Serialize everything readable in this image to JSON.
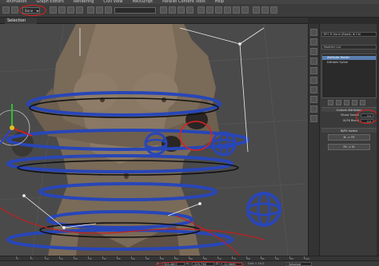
{
  "menu": {
    "items": [
      "Animation",
      "Graph Editors",
      "Rendering",
      "Civil View",
      "MAXScript",
      "Parallel Content Tools",
      "Help"
    ]
  },
  "toolbar": {
    "selection_filter": "Bone",
    "selection_set_dropdown": ""
  },
  "ribbon": {
    "tab_selection": "Selection"
  },
  "command_panel": {
    "object_name": "RFC R Hand (Biped) IK Ctrl",
    "modifier_list_label": "Modifier List",
    "stack_items": [
      "Attribute Holder",
      "Editable Spline"
    ],
    "rollout_title": "Custom Attributes",
    "params": [
      {
        "label": "Elbow Swivel",
        "value": "0.0"
      },
      {
        "label": "IK/FK Blend",
        "value": "0.0"
      }
    ],
    "section_title": "IK/FK Switch",
    "buttons": [
      "IK -> FK",
      "FK -> IK"
    ]
  },
  "timeline": {
    "tick_labels": [
      "0",
      "5",
      "10",
      "15",
      "20",
      "25",
      "30",
      "35",
      "40",
      "45",
      "50",
      "55",
      "60",
      "65",
      "70",
      "75",
      "80",
      "85",
      "90",
      "95",
      "100"
    ]
  },
  "status": {
    "x_label": "X:",
    "x_value": "300.4607",
    "y_label": "Y:",
    "y_value": "-225.738",
    "z_label": "Z:",
    "z_value": "-12.9869",
    "grid_text": "Grid = 10.0",
    "key_filter": "Selected"
  },
  "colors": {
    "highlight": "#e02020",
    "viewport_bg": "#4a4a4a",
    "control_blue": "#2846b8",
    "skin_tone": "#7a6a58",
    "stack_active": "#5a7fb0"
  }
}
